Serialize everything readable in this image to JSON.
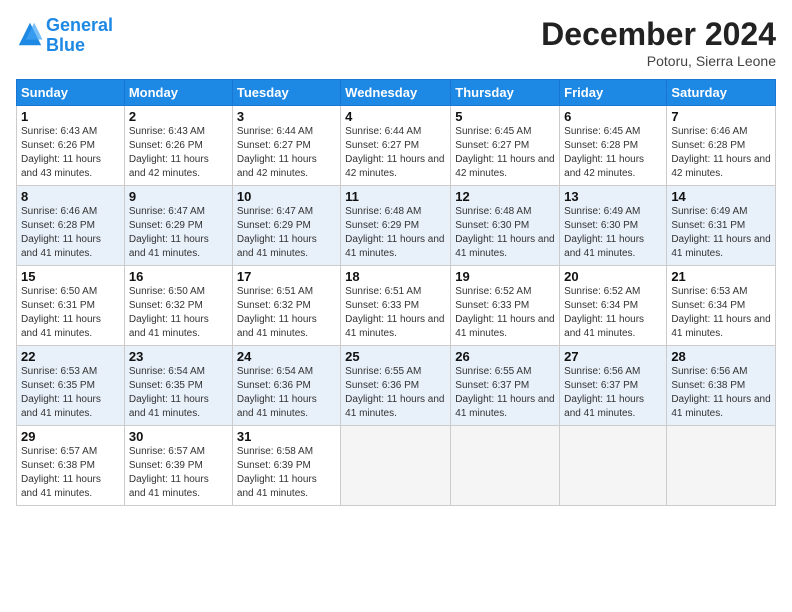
{
  "logo": {
    "line1": "General",
    "line2": "Blue"
  },
  "title": "December 2024",
  "location": "Potoru, Sierra Leone",
  "days_header": [
    "Sunday",
    "Monday",
    "Tuesday",
    "Wednesday",
    "Thursday",
    "Friday",
    "Saturday"
  ],
  "weeks": [
    [
      {
        "num": "1",
        "sunrise": "6:43 AM",
        "sunset": "6:26 PM",
        "daylight": "11 hours and 43 minutes."
      },
      {
        "num": "2",
        "sunrise": "6:43 AM",
        "sunset": "6:26 PM",
        "daylight": "11 hours and 42 minutes."
      },
      {
        "num": "3",
        "sunrise": "6:44 AM",
        "sunset": "6:27 PM",
        "daylight": "11 hours and 42 minutes."
      },
      {
        "num": "4",
        "sunrise": "6:44 AM",
        "sunset": "6:27 PM",
        "daylight": "11 hours and 42 minutes."
      },
      {
        "num": "5",
        "sunrise": "6:45 AM",
        "sunset": "6:27 PM",
        "daylight": "11 hours and 42 minutes."
      },
      {
        "num": "6",
        "sunrise": "6:45 AM",
        "sunset": "6:28 PM",
        "daylight": "11 hours and 42 minutes."
      },
      {
        "num": "7",
        "sunrise": "6:46 AM",
        "sunset": "6:28 PM",
        "daylight": "11 hours and 42 minutes."
      }
    ],
    [
      {
        "num": "8",
        "sunrise": "6:46 AM",
        "sunset": "6:28 PM",
        "daylight": "11 hours and 41 minutes."
      },
      {
        "num": "9",
        "sunrise": "6:47 AM",
        "sunset": "6:29 PM",
        "daylight": "11 hours and 41 minutes."
      },
      {
        "num": "10",
        "sunrise": "6:47 AM",
        "sunset": "6:29 PM",
        "daylight": "11 hours and 41 minutes."
      },
      {
        "num": "11",
        "sunrise": "6:48 AM",
        "sunset": "6:29 PM",
        "daylight": "11 hours and 41 minutes."
      },
      {
        "num": "12",
        "sunrise": "6:48 AM",
        "sunset": "6:30 PM",
        "daylight": "11 hours and 41 minutes."
      },
      {
        "num": "13",
        "sunrise": "6:49 AM",
        "sunset": "6:30 PM",
        "daylight": "11 hours and 41 minutes."
      },
      {
        "num": "14",
        "sunrise": "6:49 AM",
        "sunset": "6:31 PM",
        "daylight": "11 hours and 41 minutes."
      }
    ],
    [
      {
        "num": "15",
        "sunrise": "6:50 AM",
        "sunset": "6:31 PM",
        "daylight": "11 hours and 41 minutes."
      },
      {
        "num": "16",
        "sunrise": "6:50 AM",
        "sunset": "6:32 PM",
        "daylight": "11 hours and 41 minutes."
      },
      {
        "num": "17",
        "sunrise": "6:51 AM",
        "sunset": "6:32 PM",
        "daylight": "11 hours and 41 minutes."
      },
      {
        "num": "18",
        "sunrise": "6:51 AM",
        "sunset": "6:33 PM",
        "daylight": "11 hours and 41 minutes."
      },
      {
        "num": "19",
        "sunrise": "6:52 AM",
        "sunset": "6:33 PM",
        "daylight": "11 hours and 41 minutes."
      },
      {
        "num": "20",
        "sunrise": "6:52 AM",
        "sunset": "6:34 PM",
        "daylight": "11 hours and 41 minutes."
      },
      {
        "num": "21",
        "sunrise": "6:53 AM",
        "sunset": "6:34 PM",
        "daylight": "11 hours and 41 minutes."
      }
    ],
    [
      {
        "num": "22",
        "sunrise": "6:53 AM",
        "sunset": "6:35 PM",
        "daylight": "11 hours and 41 minutes."
      },
      {
        "num": "23",
        "sunrise": "6:54 AM",
        "sunset": "6:35 PM",
        "daylight": "11 hours and 41 minutes."
      },
      {
        "num": "24",
        "sunrise": "6:54 AM",
        "sunset": "6:36 PM",
        "daylight": "11 hours and 41 minutes."
      },
      {
        "num": "25",
        "sunrise": "6:55 AM",
        "sunset": "6:36 PM",
        "daylight": "11 hours and 41 minutes."
      },
      {
        "num": "26",
        "sunrise": "6:55 AM",
        "sunset": "6:37 PM",
        "daylight": "11 hours and 41 minutes."
      },
      {
        "num": "27",
        "sunrise": "6:56 AM",
        "sunset": "6:37 PM",
        "daylight": "11 hours and 41 minutes."
      },
      {
        "num": "28",
        "sunrise": "6:56 AM",
        "sunset": "6:38 PM",
        "daylight": "11 hours and 41 minutes."
      }
    ],
    [
      {
        "num": "29",
        "sunrise": "6:57 AM",
        "sunset": "6:38 PM",
        "daylight": "11 hours and 41 minutes."
      },
      {
        "num": "30",
        "sunrise": "6:57 AM",
        "sunset": "6:39 PM",
        "daylight": "11 hours and 41 minutes."
      },
      {
        "num": "31",
        "sunrise": "6:58 AM",
        "sunset": "6:39 PM",
        "daylight": "11 hours and 41 minutes."
      },
      null,
      null,
      null,
      null
    ]
  ]
}
